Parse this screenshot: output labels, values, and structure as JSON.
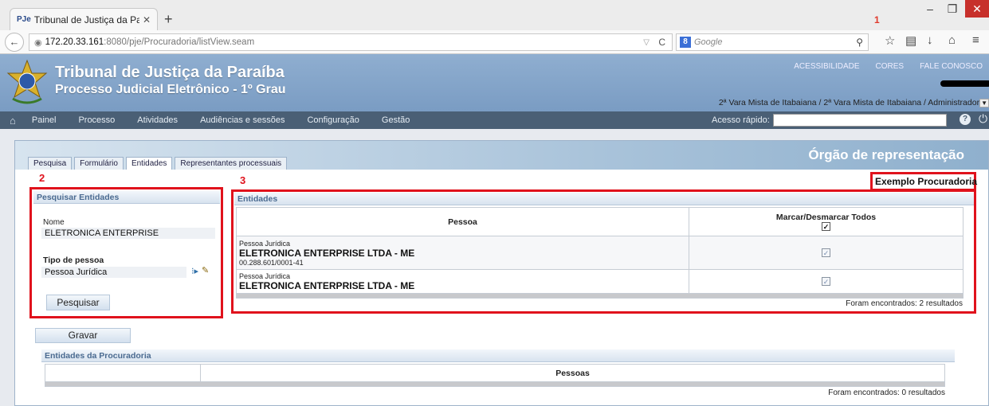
{
  "browser": {
    "tab_title": "Tribunal de Justiça da Paraí...",
    "favicon": "PJe",
    "url_host": "172.20.33.161",
    "url_path": ":8080/pje/Procuradoria/listView.seam",
    "search_placeholder": "Google"
  },
  "site": {
    "title": "Tribunal de Justiça da Paraíba",
    "subtitle": "Processo Judicial Eletrônico - 1º Grau",
    "links": [
      "ACESSIBILIDADE",
      "CORES",
      "FALE CONOSCO"
    ],
    "user_info": "2ª Vara Mista de Itabaiana / 2ª Vara Mista de Itabaiana / Administrador"
  },
  "menu": {
    "items": [
      "Painel",
      "Processo",
      "Atividades",
      "Audiências e sessões",
      "Configuração",
      "Gestão"
    ],
    "quick_access_label": "Acesso rápido:"
  },
  "page": {
    "org_title": "Órgão de representação",
    "org_name": "Exemplo Procuradoria",
    "tabs": [
      "Pesquisa",
      "Formulário",
      "Entidades",
      "Representantes processuais"
    ],
    "active_tab": "Entidades",
    "annotations": [
      "1",
      "2",
      "3"
    ]
  },
  "search": {
    "header": "Pesquisar Entidades",
    "name_label": "Nome",
    "name_value": "ELETRONICA ENTERPRISE",
    "type_label": "Tipo de pessoa",
    "type_value": "Pessoa Jurídica",
    "button": "Pesquisar"
  },
  "entities": {
    "header": "Entidades",
    "col_pessoa": "Pessoa",
    "col_toggle": "Marcar/Desmarcar Todos",
    "rows": [
      {
        "tipo": "Pessoa Jurídica",
        "nome": "ELETRONICA ENTERPRISE LTDA - ME",
        "doc": "00.288.601/0001-41",
        "checked": true
      },
      {
        "tipo": "Pessoa Jurídica",
        "nome": "ELETRONICA ENTERPRISE LTDA - ME",
        "doc": "",
        "checked": true
      }
    ],
    "footer": "Foram encontrados: 2 resultados"
  },
  "save_button": "Gravar",
  "procuradoria": {
    "header": "Entidades da Procuradoria",
    "col_pessoas": "Pessoas",
    "footer": "Foram encontrados: 0 resultados"
  },
  "colors": {
    "accent_red": "#e0121c",
    "header_blue": "#7a9cc3",
    "menu_bg": "#4a5f75"
  }
}
